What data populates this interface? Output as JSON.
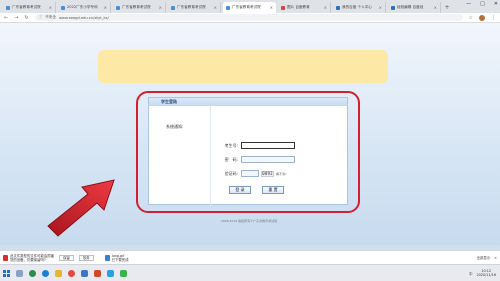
{
  "browser": {
    "tabs": [
      {
        "label": "广东省教育考试院",
        "favicon": "blue",
        "active": false
      },
      {
        "label": "2022广东小学专科",
        "favicon": "blue",
        "active": false
      },
      {
        "label": "广东省教育考试院",
        "favicon": "blue",
        "active": false
      },
      {
        "label": "广东省教育考试院",
        "favicon": "blue",
        "active": false
      },
      {
        "label": "广东省教育考试院",
        "favicon": "blue",
        "active": true
      },
      {
        "label": "图片 百度教育",
        "favicon": "red",
        "active": false
      },
      {
        "label": "我的百度 个人中心",
        "favicon": "blue2",
        "active": false
      },
      {
        "label": "经验编辑 百度经",
        "favicon": "blue2",
        "active": false
      }
    ],
    "tab_close": "×",
    "new_tab": "+",
    "window_controls": {
      "minimize": "—",
      "maximize": "□",
      "close": "✕"
    },
    "nav": {
      "back": "←",
      "forward": "→",
      "reload": "↻"
    },
    "security_label": "不安全",
    "url": "www.eeagd.edu.cn/zkyt_ks/",
    "toolbar_icons": {
      "star": "☆",
      "extensions": "⋮"
    }
  },
  "login": {
    "header": "学生登陆",
    "system_notice": "系统通知:",
    "fields": {
      "exam_no_label": "考生号:",
      "password_label": "密　码:",
      "captcha_label": "验证码:"
    },
    "captcha_code": "0092",
    "captcha_hint": "看不清?",
    "buttons": {
      "login": "登 录",
      "reset": "重 置"
    },
    "copyright": "2008-2019 版权所有©广东省教育考试院"
  },
  "downloads": {
    "items": [
      {
        "line1": "此文件类型的文件可能会损害",
        "line2": "您的设备。仍要保留吗?",
        "icon": "red"
      },
      {
        "line1": "long.gif",
        "line2": "已下载完成",
        "icon": "blue"
      }
    ],
    "keep_button": "保留",
    "discard_button": "放弃",
    "show_all": "全部显示",
    "close": "×"
  },
  "taskbar": {
    "time": "10:12",
    "date": "2020/11/16",
    "lang": "中"
  },
  "colors": {
    "highlight_outline": "#d2202f",
    "arrow": "#d2202f",
    "banner": "#fde9a5"
  }
}
